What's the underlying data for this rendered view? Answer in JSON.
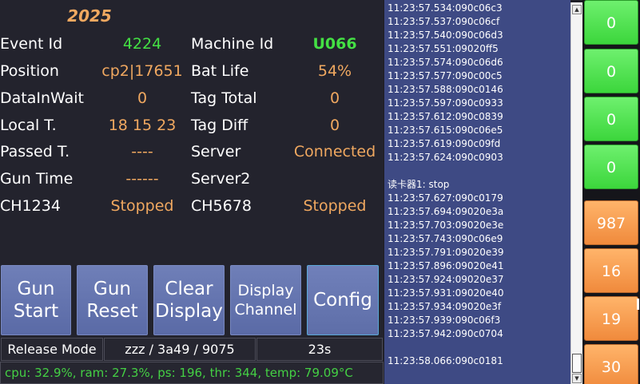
{
  "header": {
    "year": "2025"
  },
  "info": {
    "rows": [
      {
        "l1": "Event Id",
        "v1": "4224",
        "l2": "Machine Id",
        "v2": "U066"
      },
      {
        "l1": "Position",
        "v1": "cp2|17651",
        "l2": "Bat Life",
        "v2": "54%"
      },
      {
        "l1": "DataInWait",
        "v1": "0",
        "l2": "Tag Total",
        "v2": "0"
      },
      {
        "l1": "Local T.",
        "v1": "18 15 23",
        "l2": "Tag Diff",
        "v2": "0"
      },
      {
        "l1": "Passed T.",
        "v1": "----",
        "l2": "Server",
        "v2": "Connected"
      },
      {
        "l1": "Gun Time",
        "v1": "------",
        "l2": "Server2",
        "v2": ""
      },
      {
        "l1": "CH1234",
        "v1": "Stopped",
        "l2": "CH5678",
        "v2": "Stopped"
      }
    ]
  },
  "buttons": {
    "gun_start": "Gun\nStart",
    "gun_reset": "Gun\nReset",
    "clear_display": "Clear\nDisplay",
    "display_channel": "Display\nChannel",
    "config": "Config"
  },
  "status": {
    "mode": "Release Mode",
    "id_info": "zzz / 3a49 / 9075",
    "elapsed": "23s",
    "system": "cpu: 32.9%, ram: 27.3%, ps: 196, thr: 344, temp: 79.09°C"
  },
  "log": {
    "lines": [
      "11:23:57.534:090c06c3",
      "11:23:57.537:090c06cf",
      "11:23:57.540:090c06d3",
      "11:23:57.551:09020ff5",
      "11:23:57.574:090c06d6",
      "11:23:57.577:090c00c5",
      "11:23:57.588:090c0146",
      "11:23:57.597:090c0933",
      "11:23:57.612:090c0839",
      "11:23:57.615:090c06e5",
      "11:23:57.619:090c09fd",
      "11:23:57.624:090c0903",
      "",
      "读卡器1: stop",
      "11:23:57.627:090c0179",
      "11:23:57.694:09020e3a",
      "11:23:57.703:09020e3e",
      "11:23:57.743:090c06e9",
      "11:23:57.791:09020e39",
      "11:23:57.896:09020e41",
      "11:23:57.924:09020e37",
      "11:23:57.931:09020e40",
      "11:23:57.934:09020e3f",
      "11:23:57.939:090c06f3",
      "11:23:57.942:090c0704",
      "",
      "11:23:58.066:090c0181"
    ]
  },
  "counters": [
    {
      "value": "0",
      "color": "green"
    },
    {
      "value": "0",
      "color": "green"
    },
    {
      "value": "0",
      "color": "green"
    },
    {
      "value": "0",
      "color": "green"
    },
    {
      "value": "987",
      "color": "orange"
    },
    {
      "value": "16",
      "color": "orange"
    },
    {
      "value": "19",
      "color": "orange"
    },
    {
      "value": "30",
      "color": "orange"
    }
  ],
  "colors": {
    "value_orange": "#f0a860",
    "value_green": "#44e044",
    "button_blue": "#6f7fb8",
    "log_bg": "#3e4a84",
    "counter_green": "#3cd63c",
    "counter_orange": "#f08a3c"
  },
  "icons": {
    "scroll_up": "scroll-up-arrow-icon",
    "scroll_down": "scroll-down-arrow-icon"
  }
}
